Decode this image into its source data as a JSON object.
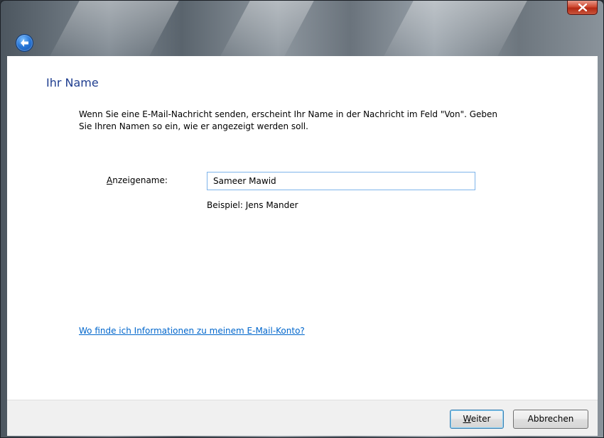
{
  "window": {
    "back_icon": "back-arrow-icon",
    "close_icon": "close-x-icon"
  },
  "page": {
    "title": "Ihr Name",
    "instruction": "Wenn Sie eine E-Mail-Nachricht senden, erscheint Ihr Name in der Nachricht im Feld \"Von\". Geben Sie Ihren Namen so ein, wie er angezeigt werden soll.",
    "display_name_label_access_key": "A",
    "display_name_label_rest": "nzeigename:",
    "display_name_value": "Sameer Mawid",
    "example": "Beispiel: Jens Mander",
    "help_link": "Wo finde ich Informationen zu meinem E-Mail-Konto?"
  },
  "footer": {
    "next_access_key": "W",
    "next_rest": "eiter",
    "cancel_label": "Abbrechen"
  },
  "colors": {
    "title": "#1e3d8f",
    "link": "#0066cc",
    "input_border": "#7eb4ea"
  }
}
